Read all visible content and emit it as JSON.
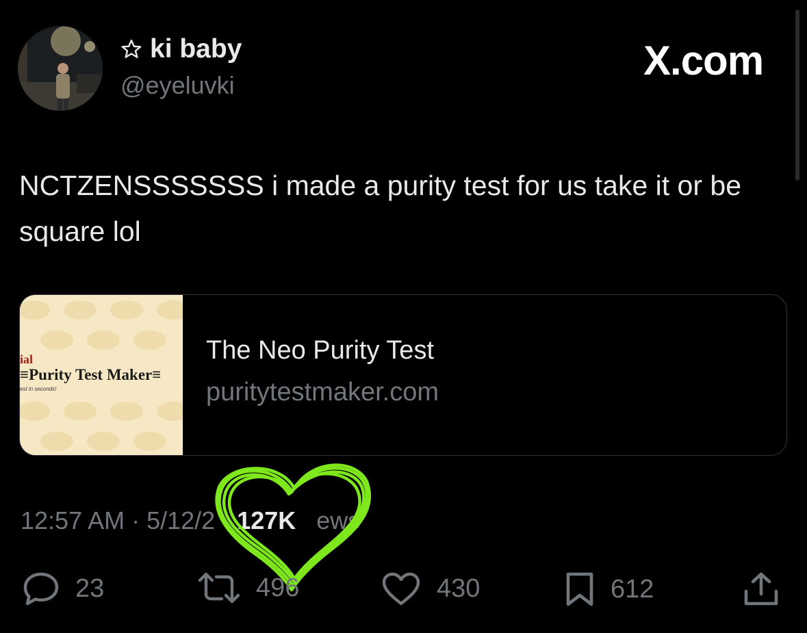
{
  "author": {
    "display_name": "ki baby",
    "name_icon": "outline-star-icon",
    "handle": "@eyeluvki"
  },
  "watermark": "X.com",
  "tweet": {
    "text": "NCTZENSSSSSSS i made a purity test for us take it or be square lol"
  },
  "link_card": {
    "thumbnail": {
      "red_text": "ial",
      "title": "≡Purity Test Maker≡",
      "subtitle": "est in seconds!"
    },
    "title": "The Neo Purity Test",
    "domain": "puritytestmaker.com"
  },
  "meta": {
    "time": "12:57 AM",
    "date": "5/12/2",
    "separator": " · ",
    "views_count": "127K",
    "views_label": "ews"
  },
  "actions": {
    "replies": "23",
    "reposts": "496",
    "likes": "430",
    "bookmarks": "612"
  },
  "colors": {
    "background": "#000000",
    "text": "#e7e9ea",
    "muted": "#71767b",
    "card_border": "#2f3336",
    "doodle": "#7ee81c"
  }
}
